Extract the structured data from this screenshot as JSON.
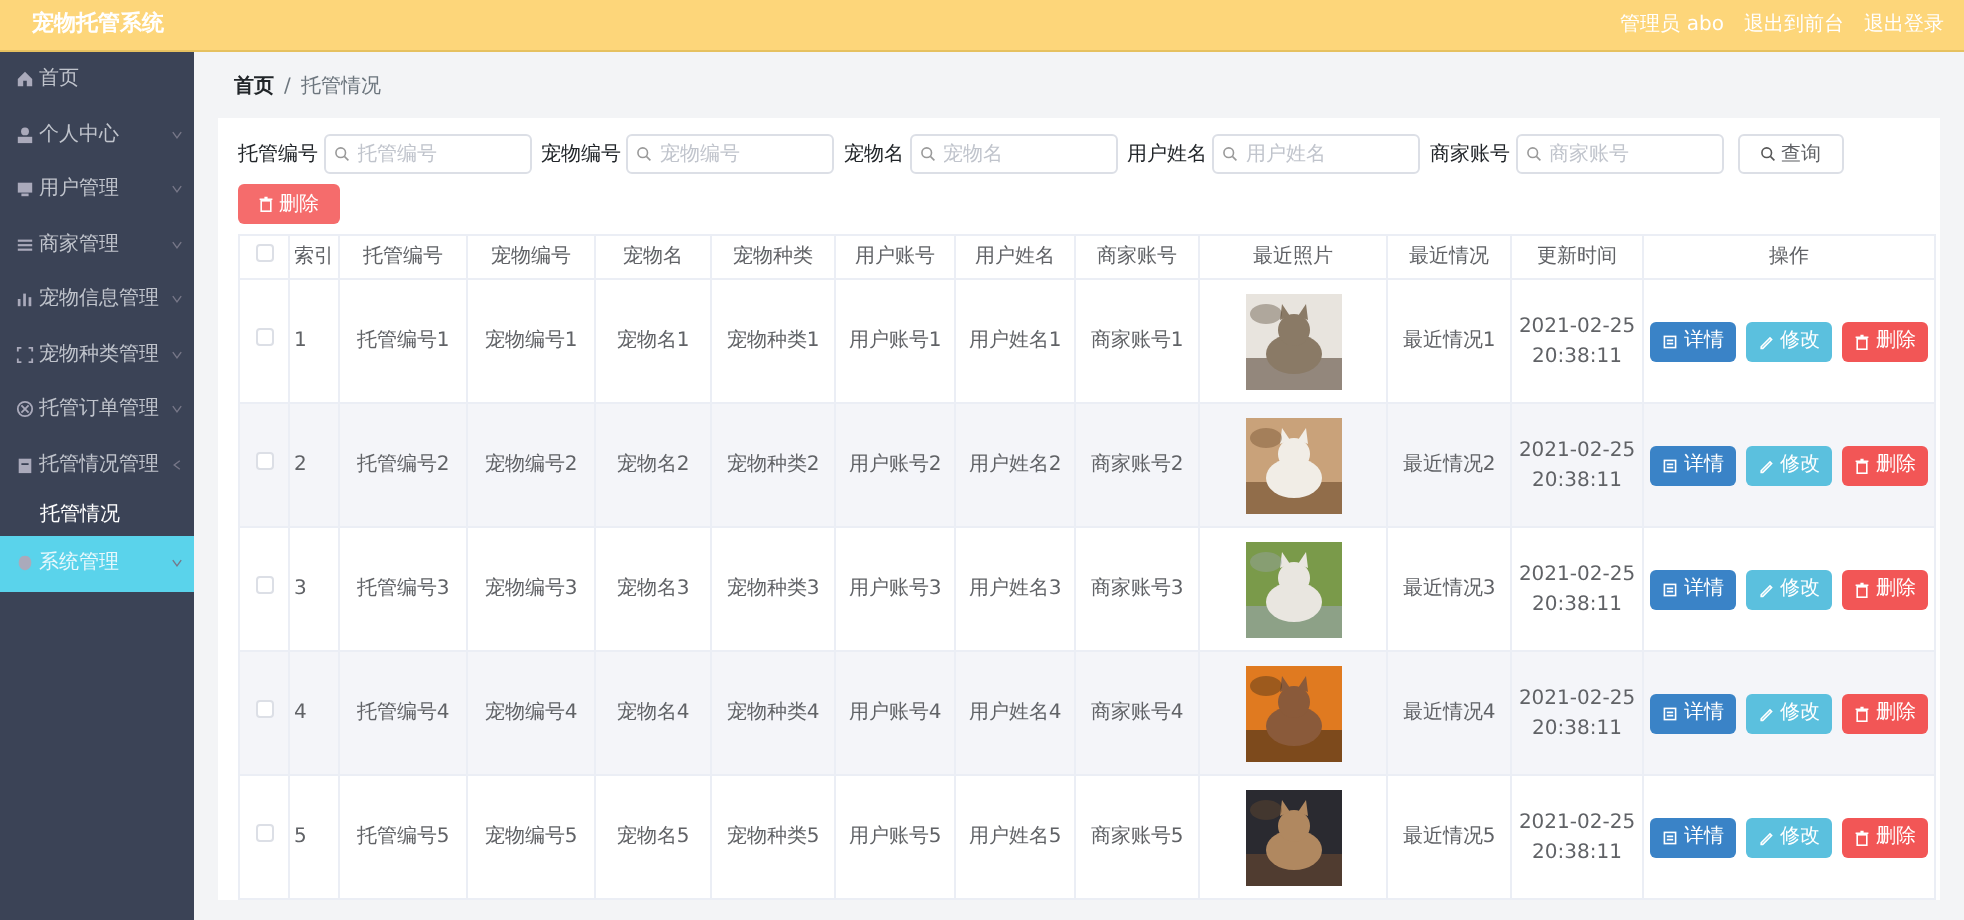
{
  "header": {
    "title": "宠物托管系统",
    "links": [
      "管理员 abo",
      "退出到前台",
      "退出登录"
    ]
  },
  "sidebar": {
    "items": [
      {
        "label": "首页",
        "highlighted": false
      },
      {
        "label": "个人中心",
        "expanded": false,
        "highlighted": false
      },
      {
        "label": "用户管理",
        "expanded": false,
        "highlighted": false
      },
      {
        "label": "商家管理",
        "expanded": false,
        "highlighted": false
      },
      {
        "label": "宠物信息管理",
        "expanded": false,
        "highlighted": false
      },
      {
        "label": "宠物种类管理",
        "expanded": false,
        "highlighted": false
      },
      {
        "label": "托管订单管理",
        "expanded": false,
        "highlighted": false
      },
      {
        "label": "托管情况管理",
        "expanded": true,
        "highlighted": false,
        "children": [
          {
            "label": "托管情况",
            "selected": true
          }
        ]
      },
      {
        "label": "系统管理",
        "expanded": false,
        "highlighted": true
      }
    ]
  },
  "breadcrumb": {
    "items": [
      "首页",
      "托管情况"
    ],
    "separator": "/"
  },
  "search": {
    "fields": [
      {
        "label": "托管编号",
        "placeholder": "托管编号"
      },
      {
        "label": "宠物编号",
        "placeholder": "宠物编号"
      },
      {
        "label": "宠物名",
        "placeholder": "宠物名"
      },
      {
        "label": "用户姓名",
        "placeholder": "用户姓名"
      },
      {
        "label": "商家账号",
        "placeholder": "商家账号"
      }
    ],
    "button": "查询"
  },
  "delete_button": "删除",
  "table": {
    "select_all": {
      "checked": false
    },
    "columns": [
      "索引",
      "托管编号",
      "宠物编号",
      "宠物名",
      "宠物种类",
      "用户账号",
      "用户姓名",
      "商家账号",
      "最近照片",
      "最近情况",
      "更新时间",
      "操作"
    ],
    "rows": [
      {
        "checked": false,
        "cells": [
          "1",
          "托管编号1",
          "宠物编号1",
          "宠物名1",
          "宠物种类1",
          "用户账号1",
          "用户姓名1",
          "商家账号1"
        ],
        "photo": {
          "kind": "picture"
        },
        "status": "最近情况1",
        "updated": "2021-02-25 20:38:11",
        "actions": [
          {
            "kind": "detail",
            "label": "详情"
          },
          {
            "kind": "edit",
            "label": "修改"
          },
          {
            "kind": "delete",
            "label": "删除"
          }
        ]
      },
      {
        "checked": false,
        "cells": [
          "2",
          "托管编号2",
          "宠物编号2",
          "宠物名2",
          "宠物种类2",
          "用户账号2",
          "用户姓名2",
          "商家账号2"
        ],
        "photo": {
          "kind": "picture"
        },
        "status": "最近情况2",
        "updated": "2021-02-25 20:38:11",
        "actions": [
          {
            "kind": "detail",
            "label": "详情"
          },
          {
            "kind": "edit",
            "label": "修改"
          },
          {
            "kind": "delete",
            "label": "删除"
          }
        ]
      },
      {
        "checked": false,
        "cells": [
          "3",
          "托管编号3",
          "宠物编号3",
          "宠物名3",
          "宠物种类3",
          "用户账号3",
          "用户姓名3",
          "商家账号3"
        ],
        "photo": {
          "kind": "picture"
        },
        "status": "最近情况3",
        "updated": "2021-02-25 20:38:11",
        "actions": [
          {
            "kind": "detail",
            "label": "详情"
          },
          {
            "kind": "edit",
            "label": "修改"
          },
          {
            "kind": "delete",
            "label": "删除"
          }
        ]
      },
      {
        "checked": false,
        "cells": [
          "4",
          "托管编号4",
          "宠物编号4",
          "宠物名4",
          "宠物种类4",
          "用户账号4",
          "用户姓名4",
          "商家账号4"
        ],
        "photo": {
          "kind": "picture"
        },
        "status": "最近情况4",
        "updated": "2021-02-25 20:38:11",
        "actions": [
          {
            "kind": "detail",
            "label": "详情"
          },
          {
            "kind": "edit",
            "label": "修改"
          },
          {
            "kind": "delete",
            "label": "删除"
          }
        ]
      },
      {
        "checked": false,
        "cells": [
          "5",
          "托管编号5",
          "宠物编号5",
          "宠物名5",
          "宠物种类5",
          "用户账号5",
          "用户姓名5",
          "商家账号5"
        ],
        "photo": {
          "kind": "picture"
        },
        "status": "最近情况5",
        "updated": "2021-02-25 20:38:11",
        "actions": [
          {
            "kind": "detail",
            "label": "详情"
          },
          {
            "kind": "edit",
            "label": "修改"
          },
          {
            "kind": "delete",
            "label": "删除"
          }
        ]
      }
    ]
  }
}
